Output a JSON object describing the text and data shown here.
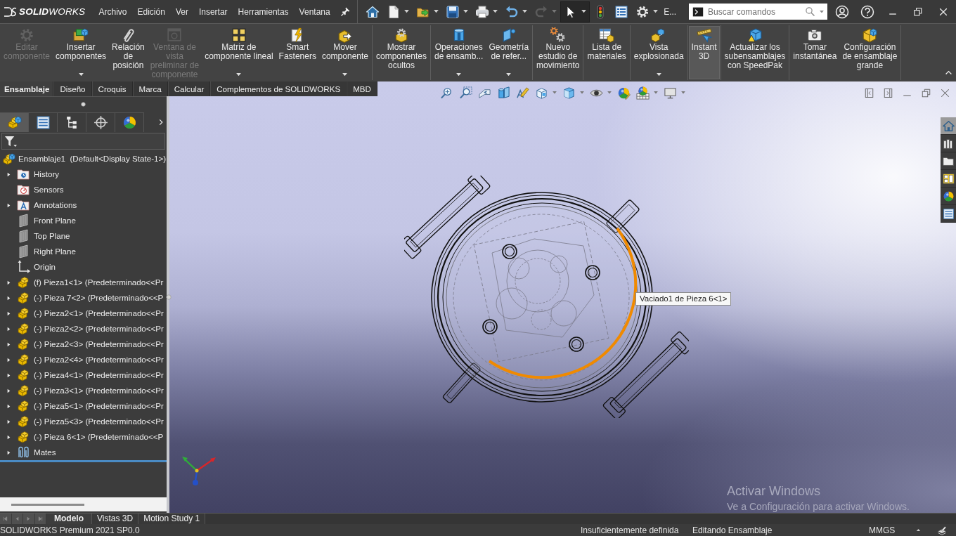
{
  "title_bar": {
    "logo": "**SOLID**WORKS",
    "menu": [
      "Archivo",
      "Edición",
      "Ver",
      "Insertar",
      "Herramientas",
      "Ventana"
    ],
    "quick_access": [
      {
        "kind": "home",
        "dropdown": false,
        "disabled": false,
        "pressed": false
      },
      {
        "kind": "new",
        "dropdown": true,
        "disabled": false,
        "pressed": false
      },
      {
        "kind": "open",
        "dropdown": true,
        "disabled": false,
        "pressed": false
      },
      {
        "kind": "save",
        "dropdown": true,
        "disabled": false,
        "pressed": false
      },
      {
        "kind": "print",
        "dropdown": true,
        "disabled": false,
        "pressed": false
      },
      {
        "kind": "undo",
        "dropdown": true,
        "disabled": false,
        "pressed": false
      },
      {
        "kind": "redo",
        "dropdown": true,
        "disabled": true,
        "pressed": false
      },
      {
        "kind": "select",
        "dropdown": true,
        "disabled": false,
        "pressed": true
      },
      {
        "kind": "rebuild",
        "dropdown": false,
        "disabled": false,
        "pressed": false
      },
      {
        "kind": "properties",
        "dropdown": false,
        "disabled": false,
        "pressed": false
      },
      {
        "kind": "options",
        "dropdown": true,
        "disabled": false,
        "pressed": false
      }
    ],
    "overflow": "E...",
    "search": {
      "placeholder": "Buscar comandos"
    }
  },
  "ribbon": {
    "groups": [
      {
        "items": [
          {
            "kind": "edit-component",
            "label": "Editar\ncomponente",
            "disabled": true,
            "selected": false,
            "dropdown": false
          },
          {
            "kind": "insert-components",
            "label": "Insertar\ncomponentes",
            "disabled": false,
            "selected": false,
            "dropdown": true
          },
          {
            "kind": "mate",
            "label": "Relación\nde\nposición",
            "disabled": false,
            "selected": false,
            "dropdown": false
          },
          {
            "kind": "preview-window",
            "label": "Ventana de\nvista\npreliminar de\ncomponente",
            "disabled": true,
            "selected": false,
            "dropdown": false
          },
          {
            "kind": "linear-pattern",
            "label": "Matriz de\ncomponente lineal",
            "disabled": false,
            "selected": false,
            "dropdown": true
          },
          {
            "kind": "smart-fasteners",
            "label": "Smart\nFasteners",
            "disabled": false,
            "selected": false,
            "dropdown": false
          },
          {
            "kind": "move-component",
            "label": "Mover\ncomponente",
            "disabled": false,
            "selected": false,
            "dropdown": true
          }
        ]
      },
      {
        "items": [
          {
            "kind": "show-hidden",
            "label": "Mostrar\ncomponentes\nocultos",
            "disabled": false,
            "selected": false,
            "dropdown": false
          }
        ]
      },
      {
        "items": [
          {
            "kind": "assembly-features",
            "label": "Operaciones\nde ensamb...",
            "disabled": false,
            "selected": false,
            "dropdown": true
          },
          {
            "kind": "reference-geometry",
            "label": "Geometría\nde refer...",
            "disabled": false,
            "selected": false,
            "dropdown": true
          }
        ]
      },
      {
        "items": [
          {
            "kind": "motion-study",
            "label": "Nuevo\nestudio de\nmovimiento",
            "disabled": false,
            "selected": false,
            "dropdown": false
          }
        ]
      },
      {
        "items": [
          {
            "kind": "bom",
            "label": "Lista de\nmateriales",
            "disabled": false,
            "selected": false,
            "dropdown": false
          }
        ]
      },
      {
        "items": [
          {
            "kind": "exploded-view",
            "label": "Vista\nexplosionada",
            "disabled": false,
            "selected": false,
            "dropdown": true
          }
        ]
      },
      {
        "items": [
          {
            "kind": "instant-3d",
            "label": "Instant\n3D",
            "disabled": false,
            "selected": true,
            "dropdown": false
          }
        ]
      },
      {
        "items": [
          {
            "kind": "speedpak",
            "label": "Actualizar los\nsubensamblajes\ncon SpeedPak",
            "disabled": false,
            "selected": false,
            "dropdown": false
          }
        ]
      },
      {
        "items": [
          {
            "kind": "snapshot",
            "label": "Tomar\ninstantánea",
            "disabled": false,
            "selected": false,
            "dropdown": false
          },
          {
            "kind": "large-assembly",
            "label": "Configuración\nde ensamblaje\ngrande",
            "disabled": false,
            "selected": false,
            "dropdown": false
          }
        ]
      }
    ]
  },
  "ribbon_tabs": [
    {
      "label": "Ensamblaje",
      "selected": true
    },
    {
      "label": "Diseño",
      "selected": false
    },
    {
      "label": "Croquis",
      "selected": false
    },
    {
      "label": "Marca",
      "selected": false
    },
    {
      "label": "Calcular",
      "selected": false
    },
    {
      "label": "Complementos de SOLIDWORKS",
      "selected": false
    },
    {
      "label": "MBD",
      "selected": false
    }
  ],
  "feature_manager": {
    "tabs": [
      {
        "kind": "feature-tree",
        "selected": true
      },
      {
        "kind": "property",
        "selected": false
      },
      {
        "kind": "configuration",
        "selected": false
      },
      {
        "kind": "dimxpert",
        "selected": false
      },
      {
        "kind": "display",
        "selected": false
      }
    ],
    "tree": {
      "root": {
        "kind": "assembly",
        "label": "Ensamblaje1  (Default<Display State-1>)",
        "children": [
          {
            "kind": "history",
            "label": "History",
            "expandable": true
          },
          {
            "kind": "sensors",
            "label": "Sensors",
            "expandable": false
          },
          {
            "kind": "annotations",
            "label": "Annotations",
            "expandable": true
          },
          {
            "kind": "plane",
            "label": "Front Plane",
            "expandable": false
          },
          {
            "kind": "plane",
            "label": "Top Plane",
            "expandable": false
          },
          {
            "kind": "plane",
            "label": "Right Plane",
            "expandable": false
          },
          {
            "kind": "origin",
            "label": "Origin",
            "expandable": false
          },
          {
            "kind": "part",
            "label": "(f) Pieza1<1> (Predeterminado<<Pr",
            "expandable": true
          },
          {
            "kind": "part",
            "label": "(-) Pieza 7<2> (Predeterminado<<P",
            "expandable": true
          },
          {
            "kind": "part",
            "label": "(-) Pieza2<1> (Predeterminado<<Pr",
            "expandable": true
          },
          {
            "kind": "part",
            "label": "(-) Pieza2<2> (Predeterminado<<Pr",
            "expandable": true
          },
          {
            "kind": "part",
            "label": "(-) Pieza2<3> (Predeterminado<<Pr",
            "expandable": true
          },
          {
            "kind": "part",
            "label": "(-) Pieza2<4> (Predeterminado<<Pr",
            "expandable": true
          },
          {
            "kind": "part",
            "label": "(-) Pieza4<1> (Predeterminado<<Pr",
            "expandable": true
          },
          {
            "kind": "part",
            "label": "(-) Pieza3<1> (Predeterminado<<Pr",
            "expandable": true
          },
          {
            "kind": "part",
            "label": "(-) Pieza5<1> (Predeterminado<<Pr",
            "expandable": true
          },
          {
            "kind": "part",
            "label": "(-) Pieza5<3> (Predeterminado<<Pr",
            "expandable": true
          },
          {
            "kind": "part",
            "label": "(-) Pieza 6<1> (Predeterminado<<P",
            "expandable": true
          },
          {
            "kind": "mates",
            "label": "Mates",
            "expandable": true
          }
        ]
      }
    }
  },
  "viewport": {
    "tooltip": "Vaciado1 de Pieza 6<1>",
    "task_pane": [
      {
        "kind": "home",
        "selected": true
      },
      {
        "kind": "library",
        "selected": false
      },
      {
        "kind": "explorer",
        "selected": false
      },
      {
        "kind": "palette",
        "selected": false
      },
      {
        "kind": "appearances",
        "selected": false
      },
      {
        "kind": "custom-properties",
        "selected": false
      }
    ]
  },
  "windows_notice": {
    "title": "Activar Windows",
    "message": "Ve a Configuración para activar Windows."
  },
  "bottom_tabs": [
    {
      "label": "Modelo",
      "selected": true
    },
    {
      "label": "Vistas 3D",
      "selected": false
    },
    {
      "label": "Motion Study 1",
      "selected": false
    }
  ],
  "status_bar": {
    "product": "SOLIDWORKS Premium 2021 SP0.0",
    "definition": "Insuficientemente definida",
    "mode": "Editando Ensamblaje",
    "units": "MMGS"
  }
}
